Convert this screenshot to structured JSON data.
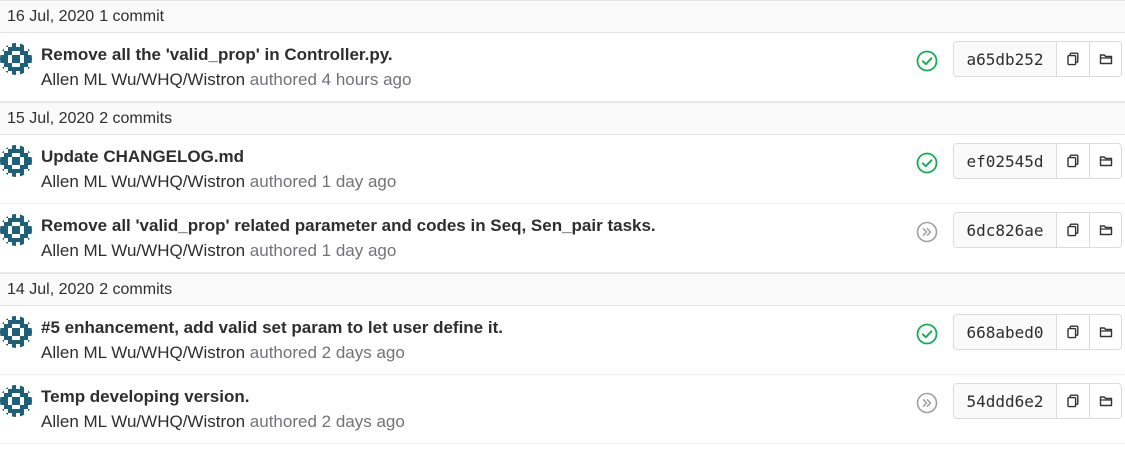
{
  "colors": {
    "success": "#1aaa55",
    "skipped": "#a0a0a0",
    "muted_text": "#737278",
    "avatar_dark": "#1f5f78",
    "avatar_light": "#ffffff"
  },
  "groups": [
    {
      "date": "16 Jul, 2020",
      "count": "1 commit",
      "commits": [
        {
          "title": "Remove all the 'valid_prop' in Controller.py.",
          "author": "Allen ML Wu/WHQ/Wistron",
          "authored": "authored",
          "time": "4 hours ago",
          "status": "passed",
          "status_icon": "check-circle-icon",
          "sha": "a65db252"
        }
      ]
    },
    {
      "date": "15 Jul, 2020",
      "count": "2 commits",
      "commits": [
        {
          "title": "Update CHANGELOG.md",
          "author": "Allen ML Wu/WHQ/Wistron",
          "authored": "authored",
          "time": "1 day ago",
          "status": "passed",
          "status_icon": "check-circle-icon",
          "sha": "ef02545d"
        },
        {
          "title": "Remove all 'valid_prop' related parameter and codes in Seq, Sen_pair tasks.",
          "author": "Allen ML Wu/WHQ/Wistron",
          "authored": "authored",
          "time": "1 day ago",
          "status": "skipped",
          "status_icon": "skipped-circle-icon",
          "sha": "6dc826ae"
        }
      ]
    },
    {
      "date": "14 Jul, 2020",
      "count": "2 commits",
      "commits": [
        {
          "title": "#5 enhancement, add valid set param to let user define it.",
          "author": "Allen ML Wu/WHQ/Wistron",
          "authored": "authored",
          "time": "2 days ago",
          "status": "passed",
          "status_icon": "check-circle-icon",
          "sha": "668abed0"
        },
        {
          "title": "Temp developing version.",
          "author": "Allen ML Wu/WHQ/Wistron",
          "authored": "authored",
          "time": "2 days ago",
          "status": "skipped",
          "status_icon": "skipped-circle-icon",
          "sha": "54ddd6e2"
        }
      ]
    }
  ]
}
